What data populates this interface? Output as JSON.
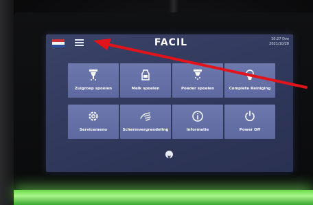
{
  "topbar": {
    "language_flag": "netherlands-flag-icon",
    "menu_icon": "hamburger-menu-icon",
    "logo": "FACIL",
    "time": "10:27 Dvo",
    "date": "2021/10/28"
  },
  "tiles": [
    {
      "label": "Zuigroep spoelen",
      "icon": "suction-group-icon"
    },
    {
      "label": "Melk spoelen",
      "icon": "milk-icon"
    },
    {
      "label": "Poeder spoelen",
      "icon": "powder-icon"
    },
    {
      "label": "Complete Reiniging",
      "icon": "cleaning-icon"
    },
    {
      "label": "Servicemenu",
      "icon": "gear-icon"
    },
    {
      "label": "Schermvergrendeling",
      "icon": "hand-icon"
    },
    {
      "label": "Informatie",
      "icon": "info-icon"
    },
    {
      "label": "Power Off",
      "icon": "power-icon"
    }
  ],
  "close_icon": "close-icon",
  "colors": {
    "screen_background": "#333b60",
    "tile": "#6671a6",
    "annotation_arrow": "#e0141a",
    "led_strip": "#7ee35c"
  }
}
